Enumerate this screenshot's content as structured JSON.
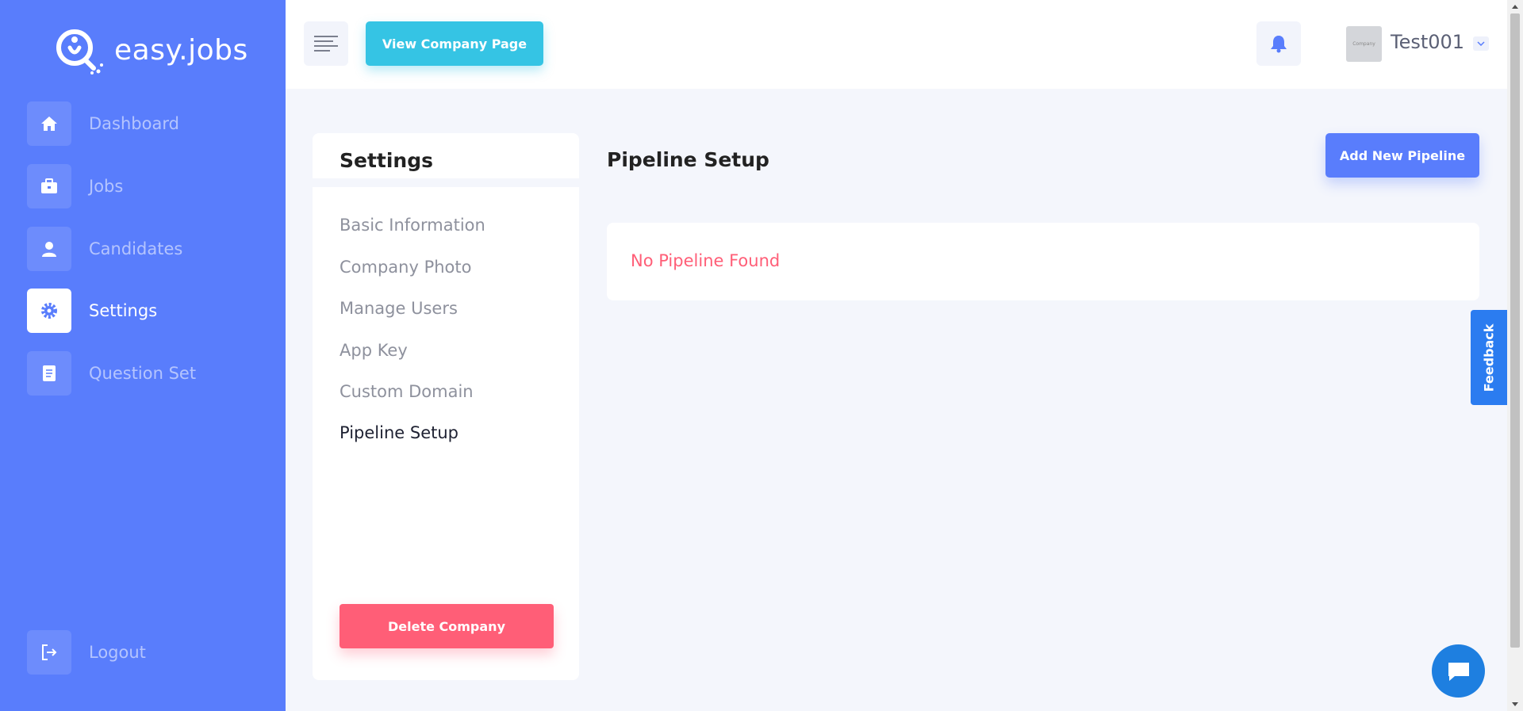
{
  "brand": {
    "name": "easy.jobs"
  },
  "sidebar": {
    "items": [
      {
        "label": "Dashboard",
        "icon": "home-icon"
      },
      {
        "label": "Jobs",
        "icon": "briefcase-icon"
      },
      {
        "label": "Candidates",
        "icon": "user-icon"
      },
      {
        "label": "Settings",
        "icon": "gear-icon",
        "active": true
      },
      {
        "label": "Question Set",
        "icon": "document-icon"
      }
    ],
    "logout_label": "Logout"
  },
  "topbar": {
    "view_company_label": "View Company Page",
    "avatar_text": "Company",
    "username": "Test001"
  },
  "settings": {
    "title": "Settings",
    "menu": [
      "Basic Information",
      "Company Photo",
      "Manage Users",
      "App Key",
      "Custom Domain",
      "Pipeline Setup"
    ],
    "active_menu": "Pipeline Setup",
    "delete_label": "Delete Company"
  },
  "main": {
    "title": "Pipeline Setup",
    "add_label": "Add New Pipeline",
    "empty_message": "No Pipeline Found"
  },
  "feedback": {
    "label": "Feedback"
  },
  "colors": {
    "sidebar": "#597dfc",
    "accent_cyan": "#35c4e4",
    "danger": "#ff5e77",
    "feedback": "#2b7cf0"
  }
}
